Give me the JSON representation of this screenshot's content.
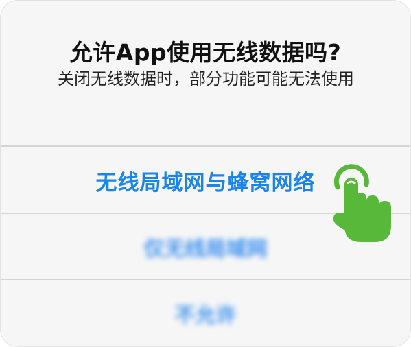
{
  "dialog": {
    "title": "允许App使用无线数据吗?",
    "message": "关闭无线数据时，部分功能可能无法使用",
    "options": [
      {
        "label": "无线局域网与蜂窝网络"
      },
      {
        "label": "仅无线局域网"
      },
      {
        "label": "不允许"
      }
    ]
  },
  "colors": {
    "accent": "#1a84ee",
    "hand": "#57b83a",
    "background": "#f6f6f6"
  },
  "icons": {
    "pointer": "tap-hand-icon"
  }
}
